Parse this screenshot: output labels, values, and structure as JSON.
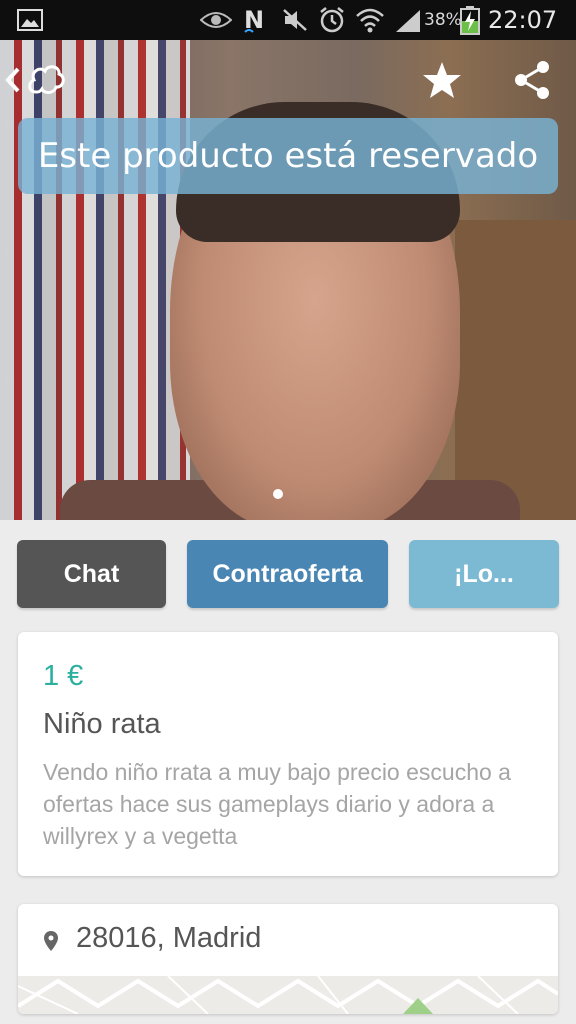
{
  "status_bar": {
    "battery_percent": "38%",
    "time": "22:07",
    "icons": [
      "image-notification-icon",
      "eye-icon",
      "n-notification-icon",
      "mute-icon",
      "alarm-icon",
      "wifi-icon",
      "signal-icon",
      "battery-charging-icon"
    ]
  },
  "header": {
    "back_icon": "chevron-left-icon",
    "logo_icon": "app-logo-icon",
    "favorite_icon": "star-icon",
    "share_icon": "share-icon"
  },
  "product": {
    "reserved_banner": "Este producto está reservado",
    "image_page_indicator": {
      "current": 1,
      "total": 1
    },
    "price": "1 €",
    "title": "Niño rata",
    "description": "Vendo niño rrata a muy bajo precio escucho a ofertas hace sus gameplays diario y adora a willyrex y a vegetta"
  },
  "actions": {
    "chat_label": "Chat",
    "counter_offer_label": "Contraoferta",
    "buy_label": "¡Lo..."
  },
  "location": {
    "text": "28016, Madrid",
    "icon": "location-pin-icon"
  },
  "colors": {
    "accent_price": "#2bb0a0",
    "chat_button": "#555555",
    "counter_offer_button": "#4a86b3",
    "buy_button": "#7cbad4",
    "reserved_banner": "#78b2d4"
  }
}
